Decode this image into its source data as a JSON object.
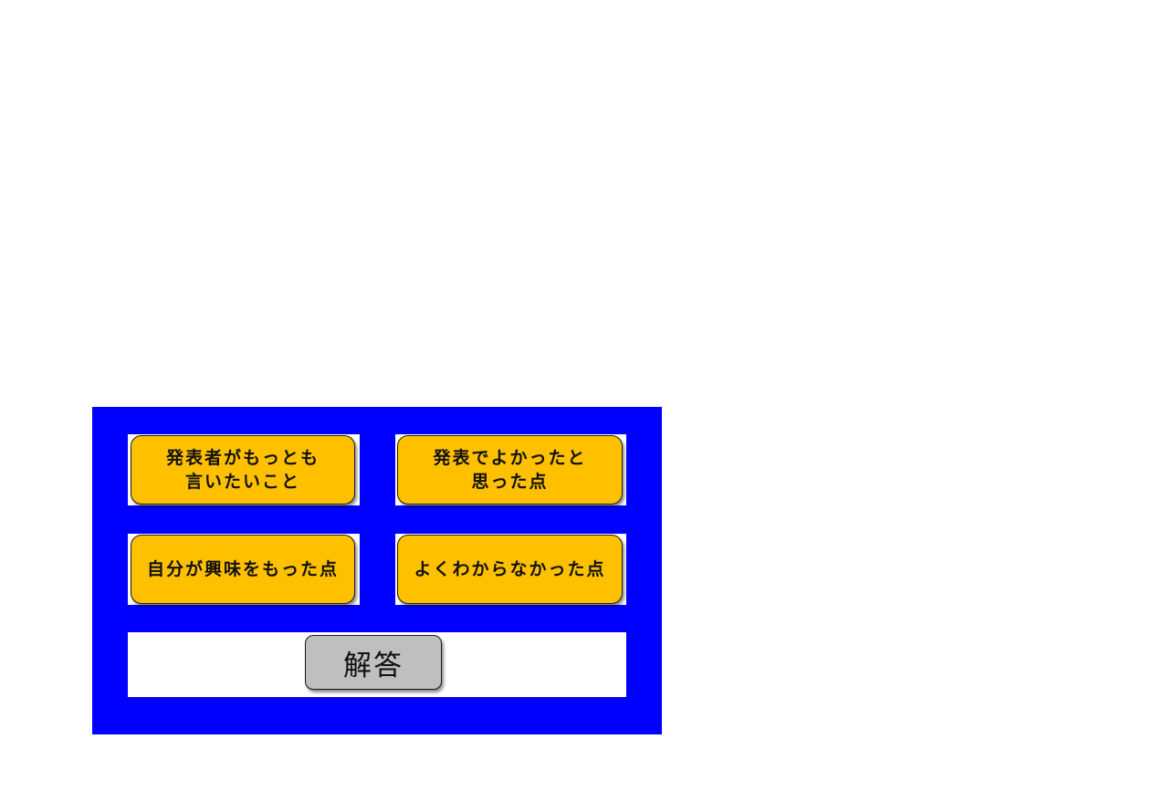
{
  "colors": {
    "panel_background": "#0000ff",
    "slot_background": "#ffffff",
    "choice_button": "#ffc000",
    "answer_button": "#bfbfbf"
  },
  "choices": [
    {
      "label": "発表者がもっとも\n言いたいこと"
    },
    {
      "label": "発表でよかったと\n思った点"
    },
    {
      "label": "自分が興味をもった点"
    },
    {
      "label": "よくわからなかった点"
    }
  ],
  "answer_button": {
    "label": "解答"
  }
}
